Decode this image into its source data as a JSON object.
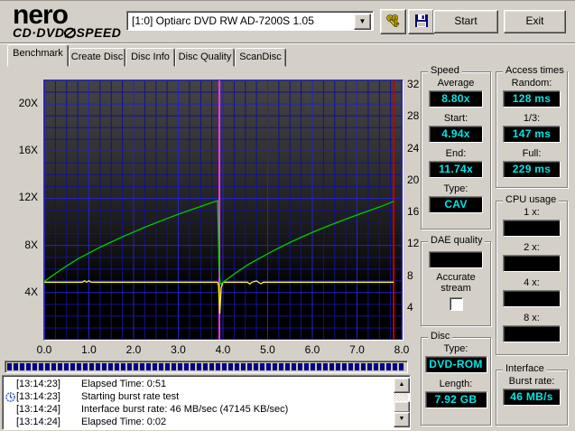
{
  "header": {
    "logo_line1": "nero",
    "logo_line2_left": "CD·DVD",
    "logo_line2_right": "SPEED",
    "drive_selector": "[1:0]  Optiarc DVD RW AD-7200S 1.05",
    "start_label": "Start",
    "exit_label": "Exit"
  },
  "icons": {
    "combo_arrow": "▼",
    "scroll_up": "▲",
    "scroll_down": "▼"
  },
  "tabs": [
    {
      "label": "Benchmark",
      "active": true
    },
    {
      "label": "Create Disc",
      "active": false
    },
    {
      "label": "Disc Info",
      "active": false
    },
    {
      "label": "Disc Quality",
      "active": false
    },
    {
      "label": "ScanDisc",
      "active": false
    }
  ],
  "chart_data": {
    "type": "line",
    "title": "",
    "x_axis": {
      "range": [
        0,
        8.02
      ],
      "grid_step": 0.25,
      "ticks": [
        {
          "v": 0,
          "label": "0.0"
        },
        {
          "v": 1,
          "label": "1.0"
        },
        {
          "v": 2,
          "label": "2.0"
        },
        {
          "v": 3,
          "label": "3.0"
        },
        {
          "v": 4,
          "label": "4.0"
        },
        {
          "v": 5,
          "label": "5.0"
        },
        {
          "v": 6,
          "label": "6.0"
        },
        {
          "v": 7,
          "label": "7.0"
        },
        {
          "v": 8,
          "label": "8.0"
        }
      ]
    },
    "y_left_axis": {
      "range": [
        0,
        22
      ],
      "grid_step": 1,
      "ticks": [
        {
          "v": 4,
          "label": "4X"
        },
        {
          "v": 8,
          "label": "8X"
        },
        {
          "v": 12,
          "label": "12X"
        },
        {
          "v": 16,
          "label": "16X"
        },
        {
          "v": 20,
          "label": "20X"
        }
      ]
    },
    "y_right_axis": {
      "range": [
        0,
        32.6
      ],
      "ticks": [
        {
          "v": 4,
          "label": "4"
        },
        {
          "v": 8,
          "label": "8"
        },
        {
          "v": 12,
          "label": "12"
        },
        {
          "v": 16,
          "label": "16"
        },
        {
          "v": 20,
          "label": "20"
        },
        {
          "v": 24,
          "label": "24"
        },
        {
          "v": 28,
          "label": "28"
        },
        {
          "v": 32,
          "label": "32"
        }
      ]
    },
    "grid_minor_color": "#12128E",
    "grid_major_color": "#2222CC",
    "plot_bg_top": "#444444",
    "plot_bg_bottom": "#000000",
    "series": [
      {
        "name": "rotation-speed-line",
        "color": "#FFFF00",
        "points": [
          [
            0,
            4.88
          ],
          [
            0.85,
            4.88
          ],
          [
            0.9,
            5.0
          ],
          [
            0.95,
            4.88
          ],
          [
            1.0,
            5.0
          ],
          [
            1.05,
            4.88
          ],
          [
            3.88,
            4.88
          ],
          [
            3.9,
            4.6
          ],
          [
            3.93,
            2.2
          ],
          [
            3.96,
            4.4
          ],
          [
            4.0,
            4.88
          ],
          [
            4.55,
            4.88
          ],
          [
            4.6,
            4.72
          ],
          [
            4.65,
            4.88
          ],
          [
            4.75,
            4.98
          ],
          [
            4.85,
            4.75
          ],
          [
            4.9,
            4.88
          ],
          [
            7.82,
            4.88
          ]
        ]
      },
      {
        "name": "read-speed-curve",
        "color": "#00CC00",
        "points": [
          [
            0,
            4.94
          ],
          [
            0.15,
            5.35
          ],
          [
            0.3,
            5.75
          ],
          [
            0.5,
            6.26
          ],
          [
            0.75,
            6.85
          ],
          [
            1.0,
            7.35
          ],
          [
            1.25,
            7.85
          ],
          [
            1.5,
            8.29
          ],
          [
            1.75,
            8.73
          ],
          [
            2.0,
            9.14
          ],
          [
            2.25,
            9.54
          ],
          [
            2.5,
            9.92
          ],
          [
            2.75,
            10.29
          ],
          [
            3.0,
            10.64
          ],
          [
            3.25,
            10.98
          ],
          [
            3.5,
            11.31
          ],
          [
            3.7,
            11.57
          ],
          [
            3.88,
            11.8
          ],
          [
            3.91,
            6.5
          ],
          [
            3.94,
            4.7
          ],
          [
            4.25,
            5.57
          ],
          [
            4.55,
            6.35
          ],
          [
            4.85,
            6.98
          ],
          [
            5.15,
            7.6
          ],
          [
            5.45,
            8.16
          ],
          [
            5.75,
            8.69
          ],
          [
            6.05,
            9.19
          ],
          [
            6.35,
            9.65
          ],
          [
            6.65,
            10.09
          ],
          [
            6.95,
            10.51
          ],
          [
            7.25,
            10.92
          ],
          [
            7.55,
            11.32
          ],
          [
            7.82,
            11.74
          ]
        ]
      }
    ],
    "markers": [
      {
        "type": "vline",
        "x": 3.92,
        "color": "#FF33FF",
        "name": "split-position-marker"
      },
      {
        "type": "vline",
        "x": 7.82,
        "color": "#C00000",
        "name": "end-position-marker"
      }
    ]
  },
  "panels": {
    "speed": {
      "title": "Speed",
      "fields": [
        {
          "label": "Average",
          "value": "8.80x"
        },
        {
          "label": "Start:",
          "value": "4.94x"
        },
        {
          "label": "End:",
          "value": "11.74x"
        },
        {
          "label": "Type:",
          "value": "CAV"
        }
      ]
    },
    "access_times": {
      "title": "Access times",
      "fields": [
        {
          "label": "Random:",
          "value": "128 ms"
        },
        {
          "label": "1/3:",
          "value": "147 ms"
        },
        {
          "label": "Full:",
          "value": "229 ms"
        }
      ]
    },
    "dae_quality": {
      "title": "DAE quality",
      "value": "",
      "checkbox_label": "Accurate stream",
      "checked": false
    },
    "cpu_usage": {
      "title": "CPU usage",
      "fields": [
        {
          "label": "1 x:",
          "value": ""
        },
        {
          "label": "2 x:",
          "value": ""
        },
        {
          "label": "4 x:",
          "value": ""
        },
        {
          "label": "8 x:",
          "value": ""
        }
      ]
    },
    "disc": {
      "title": "Disc",
      "fields": [
        {
          "label": "Type:",
          "value": "DVD-ROM"
        },
        {
          "label": "Length:",
          "value": "7.92 GB"
        }
      ]
    },
    "interface": {
      "title": "Interface",
      "fields": [
        {
          "label": "Burst rate:",
          "value": "46 MB/s"
        }
      ]
    }
  },
  "log": {
    "progress_percent": 100,
    "entries": [
      {
        "time": "[13:14:23]",
        "message": "Elapsed Time:  0:51",
        "icon": false
      },
      {
        "time": "[13:14:23]",
        "message": "Starting burst rate test",
        "icon": true
      },
      {
        "time": "[13:14:24]",
        "message": "Interface burst rate: 46 MB/sec (47145 KB/sec)",
        "icon": false
      },
      {
        "time": "[13:14:24]",
        "message": "Elapsed Time:  0:02",
        "icon": false
      }
    ]
  }
}
